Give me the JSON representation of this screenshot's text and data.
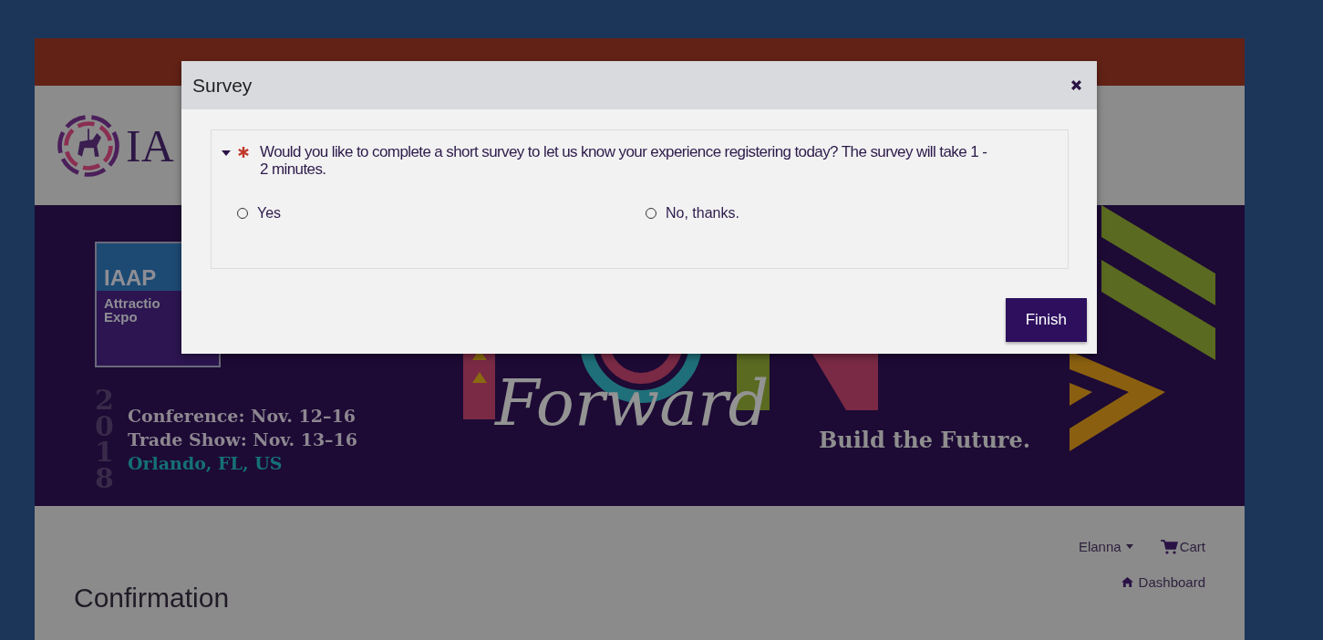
{
  "header": {
    "logo_text": "IA"
  },
  "banner": {
    "badge_lines": [
      "IAAP",
      "Attractio",
      "Expo"
    ],
    "year": "2018",
    "dates": [
      "Conference: Nov. 12–16",
      "Trade Show: Nov. 13–16"
    ],
    "location": "Orlando, FL, US",
    "script_word": "Forward",
    "tagline": "Build the Future."
  },
  "nav": {
    "user": "Elanna",
    "cart": "Cart",
    "dashboard": "Dashboard"
  },
  "page_title": "Confirmation",
  "modal": {
    "title": "Survey",
    "question": {
      "text": "Would you like to complete a short survey to let us know your experience registering today? The survey will take 1 - 2 minutes.",
      "required": true,
      "expanded": true,
      "options": [
        {
          "label": "Yes",
          "selected": false
        },
        {
          "label": "No, thanks.",
          "selected": false
        }
      ]
    },
    "button": "Finish"
  }
}
